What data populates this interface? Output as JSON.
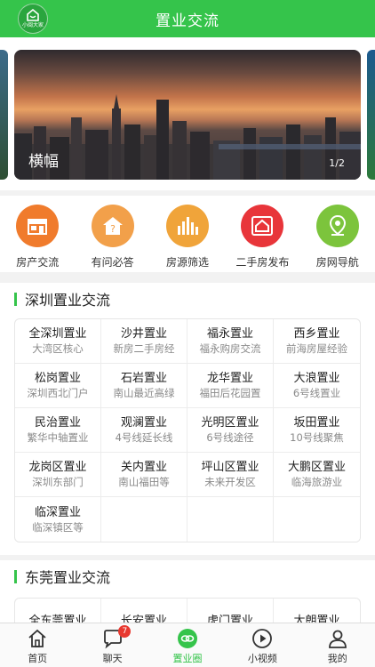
{
  "header": {
    "title": "置业交流",
    "logo_text": "小闽大家"
  },
  "banner": {
    "caption": "横幅",
    "pager": "1/2"
  },
  "quick_links": [
    {
      "label": "房产交流",
      "icon": "shop-icon",
      "color": "#f07b2c"
    },
    {
      "label": "有问必答",
      "icon": "question-house-icon",
      "color": "#f2a04a"
    },
    {
      "label": "房源筛选",
      "icon": "building-bars-icon",
      "color": "#f0a43a"
    },
    {
      "label": "二手房发布",
      "icon": "house-publish-icon",
      "color": "#e8353a"
    },
    {
      "label": "房网导航",
      "icon": "location-pin-icon",
      "color": "#7cc43c"
    }
  ],
  "sections": [
    {
      "title": "深圳置业交流",
      "items": [
        {
          "name": "全深圳置业",
          "desc": "大湾区核心"
        },
        {
          "name": "沙井置业",
          "desc": "新房二手房经"
        },
        {
          "name": "福永置业",
          "desc": "福永购房交流"
        },
        {
          "name": "西乡置业",
          "desc": "前海房屋经验"
        },
        {
          "name": "松岗置业",
          "desc": "深圳西北门户"
        },
        {
          "name": "石岩置业",
          "desc": "南山最近高绿"
        },
        {
          "name": "龙华置业",
          "desc": "福田后花园置"
        },
        {
          "name": "大浪置业",
          "desc": "6号线置业"
        },
        {
          "name": "民治置业",
          "desc": "繁华中轴置业"
        },
        {
          "name": "观澜置业",
          "desc": "4号线延长线"
        },
        {
          "name": "光明区置业",
          "desc": "6号线途径"
        },
        {
          "name": "坂田置业",
          "desc": "10号线聚焦"
        },
        {
          "name": "龙岗区置业",
          "desc": "深圳东部门"
        },
        {
          "name": "关内置业",
          "desc": "南山福田等"
        },
        {
          "name": "坪山区置业",
          "desc": "未来开发区"
        },
        {
          "name": "大鹏区置业",
          "desc": "临海旅游业"
        },
        {
          "name": "临深置业",
          "desc": "临深镇区等"
        }
      ]
    },
    {
      "title": "东莞置业交流",
      "items": [
        {
          "name": "全东莞置业",
          "desc": ""
        },
        {
          "name": "长安置业",
          "desc": ""
        },
        {
          "name": "虎门置业",
          "desc": ""
        },
        {
          "name": "大朗置业",
          "desc": ""
        }
      ]
    }
  ],
  "tabbar": [
    {
      "label": "首页",
      "icon": "home-icon",
      "active": false
    },
    {
      "label": "聊天",
      "icon": "chat-icon",
      "active": false,
      "badge": "7"
    },
    {
      "label": "置业圈",
      "icon": "circle-link-icon",
      "active": true
    },
    {
      "label": "小视频",
      "icon": "play-icon",
      "active": false
    },
    {
      "label": "我的",
      "icon": "person-icon",
      "active": false
    }
  ],
  "colors": {
    "brand_green": "#35c44b",
    "badge_red": "#e8382f"
  }
}
